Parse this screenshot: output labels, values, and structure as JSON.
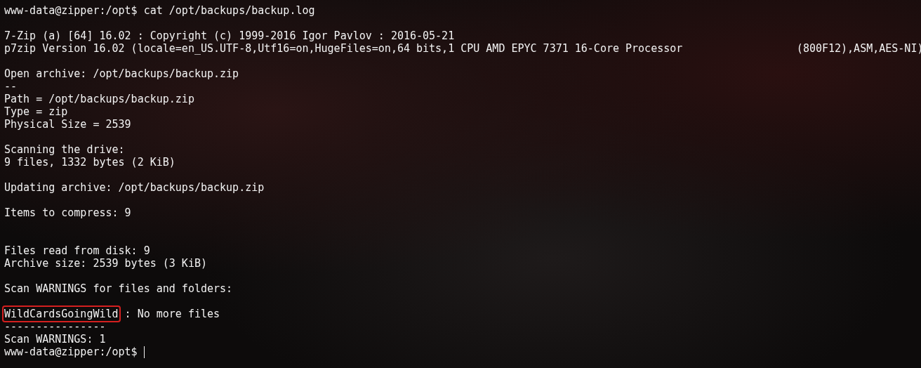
{
  "terminal": {
    "lines": [
      {
        "kind": "prompt",
        "text": "www-data@zipper:/opt$ cat /opt/backups/backup.log",
        "cursor": false
      },
      {
        "kind": "blank"
      },
      {
        "kind": "output",
        "text": "7-Zip (a) [64] 16.02 : Copyright (c) 1999-2016 Igor Pavlov : 2016-05-21"
      },
      {
        "kind": "output",
        "text": "p7zip Version 16.02 (locale=en_US.UTF-8,Utf16=on,HugeFiles=on,64 bits,1 CPU AMD EPYC 7371 16-Core Processor                  (800F12),ASM,AES-NI)"
      },
      {
        "kind": "blank"
      },
      {
        "kind": "output",
        "text": "Open archive: /opt/backups/backup.zip"
      },
      {
        "kind": "output",
        "text": "--"
      },
      {
        "kind": "output",
        "text": "Path = /opt/backups/backup.zip"
      },
      {
        "kind": "output",
        "text": "Type = zip"
      },
      {
        "kind": "output",
        "text": "Physical Size = 2539"
      },
      {
        "kind": "blank"
      },
      {
        "kind": "output",
        "text": "Scanning the drive:"
      },
      {
        "kind": "output",
        "text": "9 files, 1332 bytes (2 KiB)"
      },
      {
        "kind": "blank"
      },
      {
        "kind": "output",
        "text": "Updating archive: /opt/backups/backup.zip"
      },
      {
        "kind": "blank"
      },
      {
        "kind": "output",
        "text": "Items to compress: 9"
      },
      {
        "kind": "blank"
      },
      {
        "kind": "blank"
      },
      {
        "kind": "output",
        "text": "Files read from disk: 9"
      },
      {
        "kind": "output",
        "text": "Archive size: 2539 bytes (3 KiB)"
      },
      {
        "kind": "blank"
      },
      {
        "kind": "output",
        "text": "Scan WARNINGS for files and folders:"
      },
      {
        "kind": "blank"
      },
      {
        "kind": "parts",
        "parts": [
          {
            "text": "WildCardsGoingWild",
            "highlighted": true
          },
          {
            "text": " : No more files",
            "highlighted": false
          }
        ]
      },
      {
        "kind": "output",
        "text": "----------------"
      },
      {
        "kind": "output",
        "text": "Scan WARNINGS: 1"
      },
      {
        "kind": "prompt",
        "text": "www-data@zipper:/opt$ ",
        "cursor": true
      }
    ]
  }
}
